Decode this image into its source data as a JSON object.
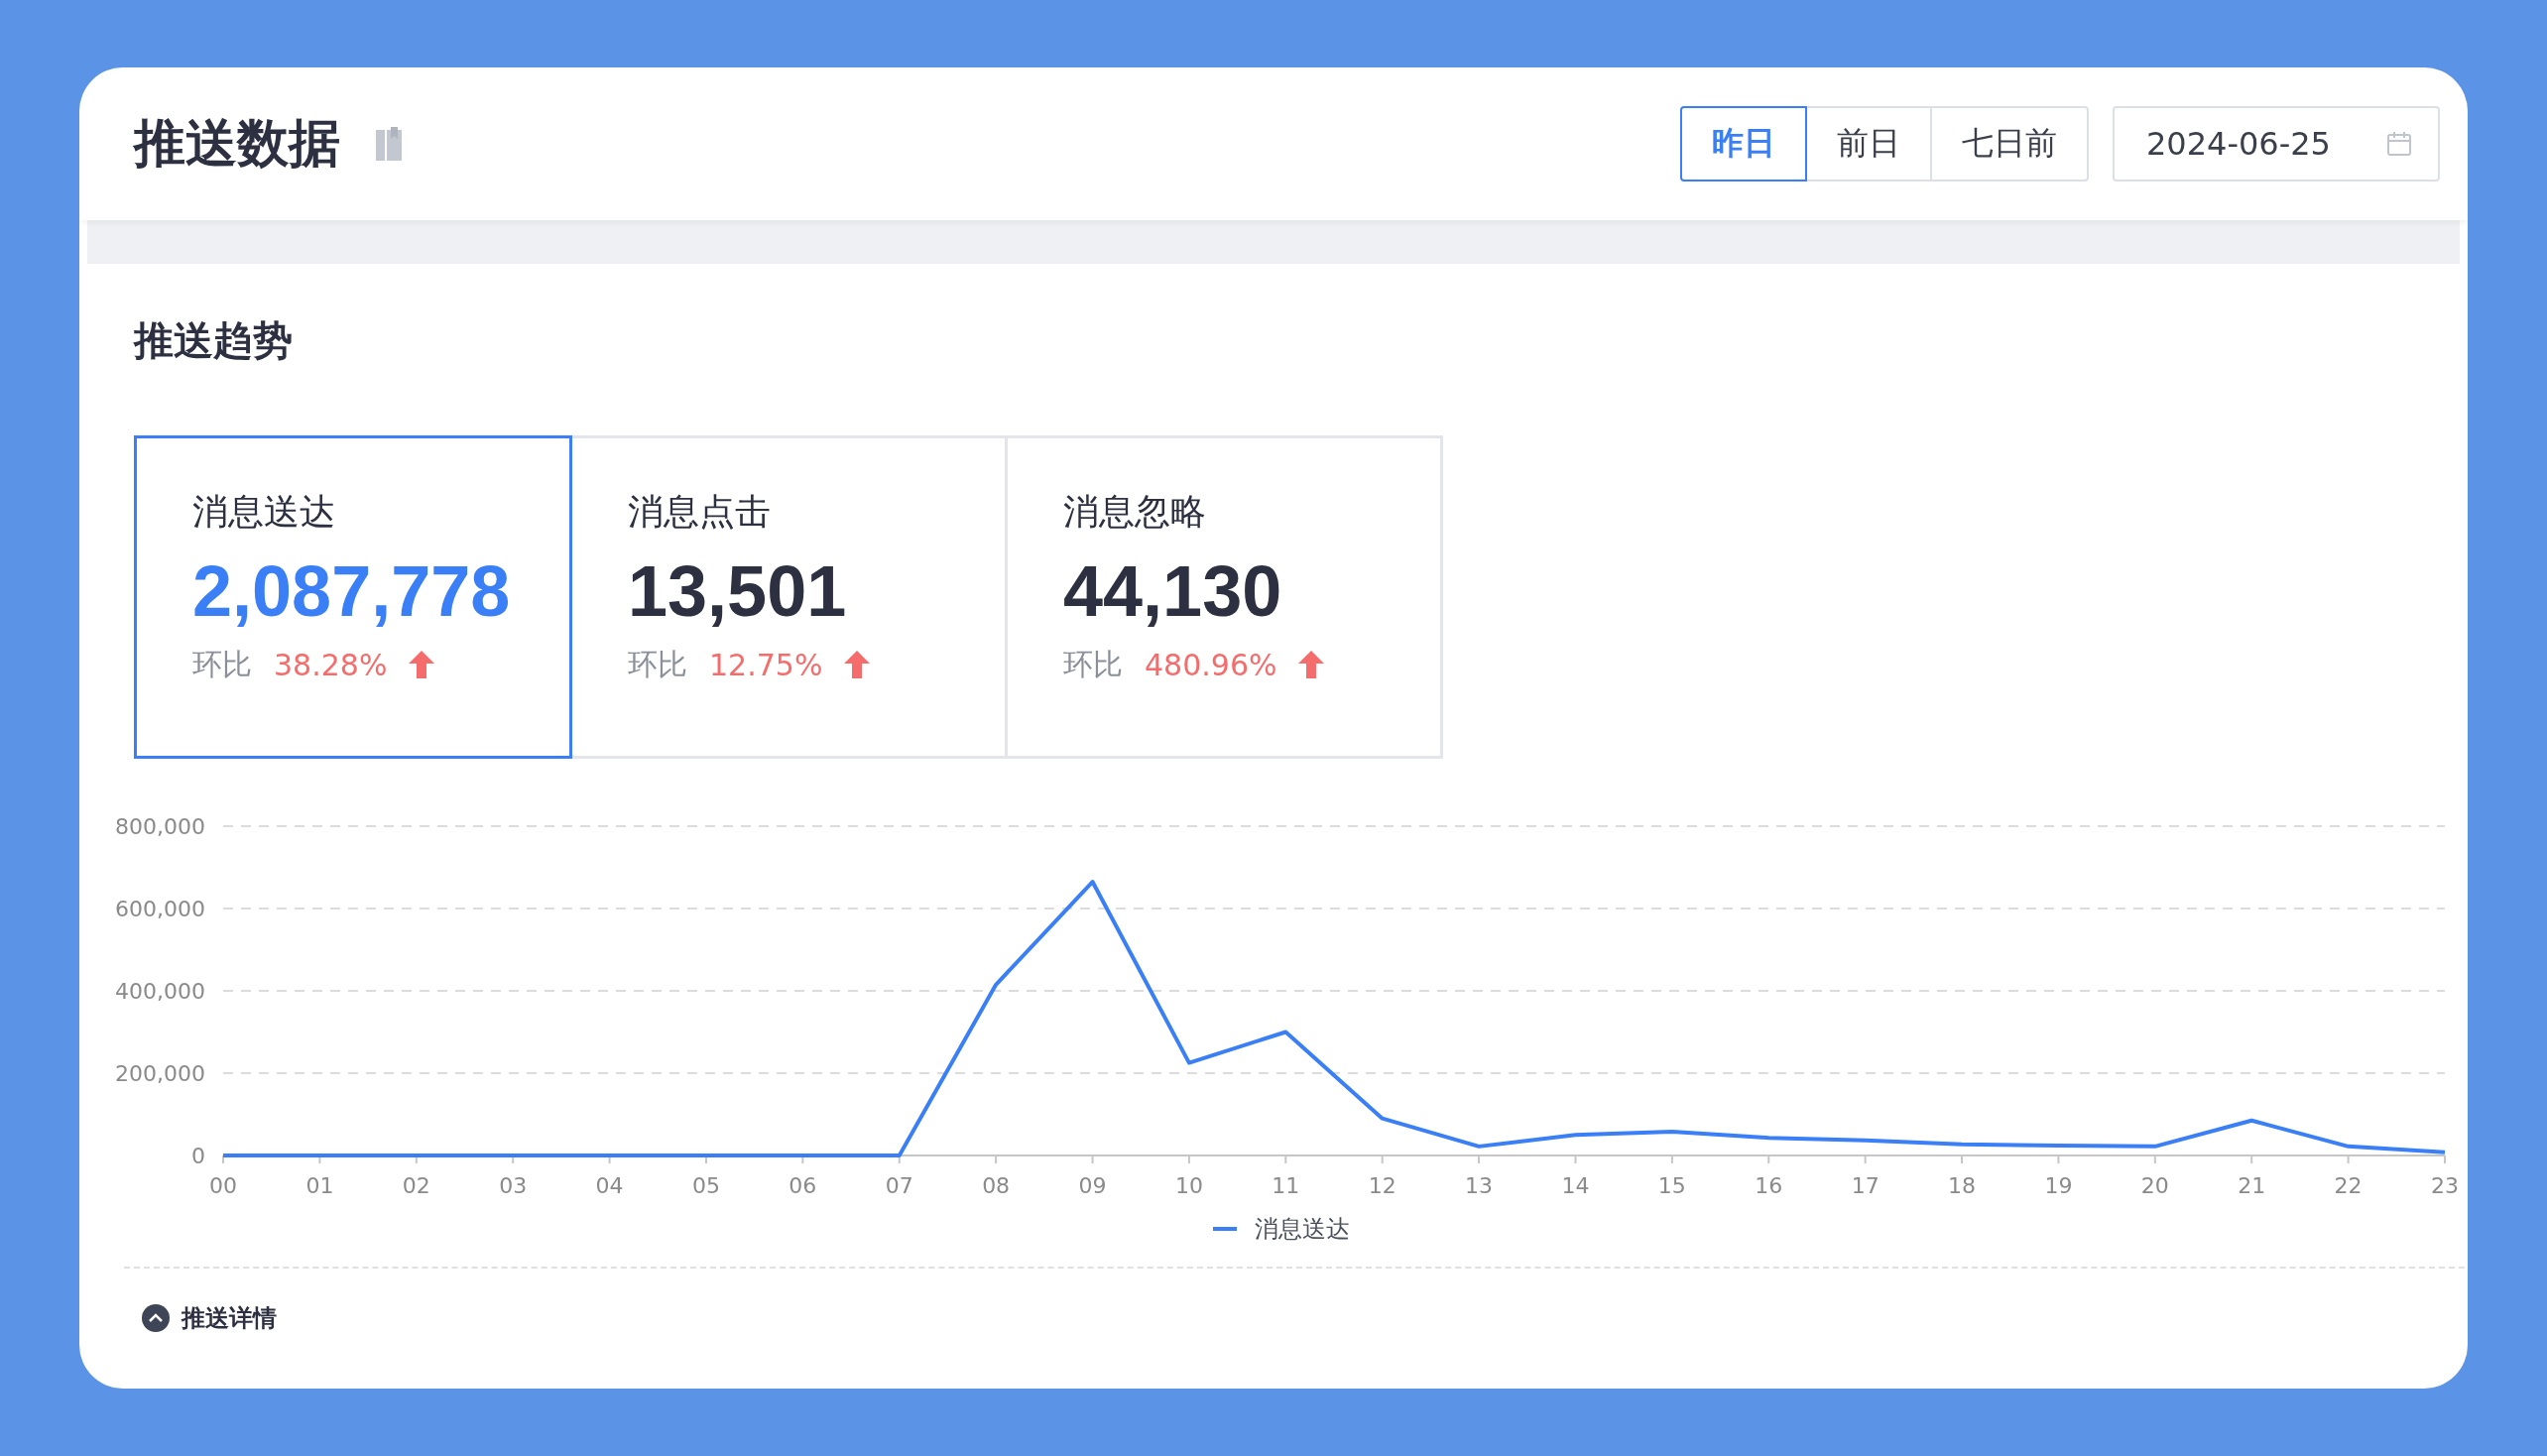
{
  "header": {
    "title": "推送数据",
    "range_buttons": [
      {
        "label": "昨日",
        "selected": true
      },
      {
        "label": "前日",
        "selected": false
      },
      {
        "label": "七日前",
        "selected": false
      }
    ],
    "date_field": {
      "value": "2024-06-25"
    }
  },
  "trend": {
    "title": "推送趋势",
    "metrics": [
      {
        "label": "消息送达",
        "value": "2,087,778",
        "compare_label": "环比",
        "change": "38.28%",
        "selected": true
      },
      {
        "label": "消息点击",
        "value": "13,501",
        "compare_label": "环比",
        "change": "12.75%",
        "selected": false
      },
      {
        "label": "消息忽略",
        "value": "44,130",
        "compare_label": "环比",
        "change": "480.96%",
        "selected": false
      }
    ],
    "chart_data": {
      "type": "line",
      "categories": [
        "00",
        "01",
        "02",
        "03",
        "04",
        "05",
        "06",
        "07",
        "08",
        "09",
        "10",
        "11",
        "12",
        "13",
        "14",
        "15",
        "16",
        "17",
        "18",
        "19",
        "20",
        "21",
        "22",
        "23"
      ],
      "ylim": [
        0,
        800000
      ],
      "grid": true,
      "yticks": [
        {
          "value": 0,
          "label": "0"
        },
        {
          "value": 200000,
          "label": "200,000"
        },
        {
          "value": 400000,
          "label": "400,000"
        },
        {
          "value": 600000,
          "label": "600,000"
        },
        {
          "value": 800000,
          "label": "800,000"
        }
      ],
      "series": [
        {
          "name": "消息送达",
          "color": "#3a7ff6",
          "values": [
            0,
            0,
            0,
            0,
            0,
            0,
            0,
            0,
            415000,
            665000,
            225000,
            300000,
            90000,
            22000,
            50000,
            58000,
            43000,
            37000,
            27000,
            24000,
            22000,
            85000,
            22000,
            8000
          ]
        }
      ]
    }
  },
  "details_toggle": {
    "label": "推送详情"
  }
}
